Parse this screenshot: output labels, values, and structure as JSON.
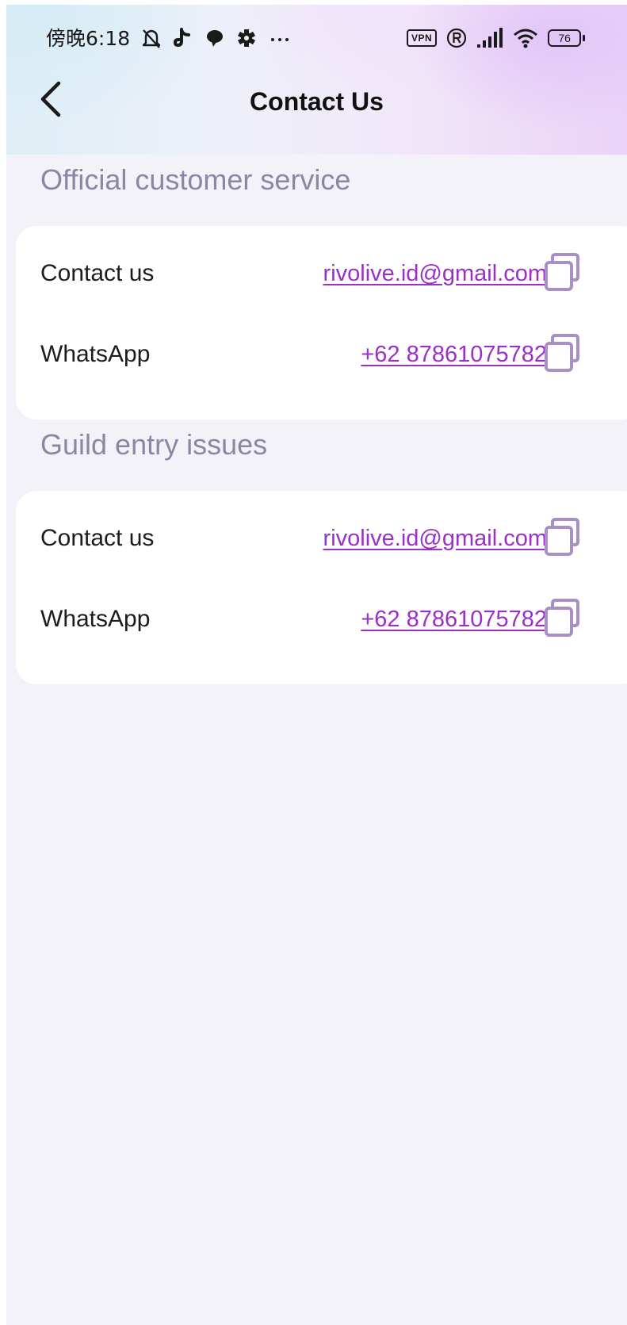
{
  "status_bar": {
    "time": "傍晚6:18",
    "vpn_label": "VPN",
    "battery_level": "76",
    "left_icons": [
      "bell-off-icon",
      "tiktok-icon",
      "chat-bubble-icon",
      "gear-icon",
      "more-icon"
    ],
    "right_icons": [
      "vpn-icon",
      "registered-icon",
      "signal-icon",
      "wifi-icon",
      "battery-icon"
    ]
  },
  "header": {
    "title": "Contact Us",
    "back_icon": "chevron-left-icon"
  },
  "sections": [
    {
      "title": "Official customer service",
      "rows": [
        {
          "label": "Contact us",
          "value": "rivolive.id@gmail.com",
          "action_icon": "copy-icon"
        },
        {
          "label": "WhatsApp",
          "value": "+62 87861075782",
          "action_icon": "copy-icon"
        }
      ]
    },
    {
      "title": "Guild entry issues",
      "rows": [
        {
          "label": "Contact us",
          "value": "rivolive.id@gmail.com",
          "action_icon": "copy-icon"
        },
        {
          "label": "WhatsApp",
          "value": "+62 87861075782",
          "action_icon": "copy-icon"
        }
      ]
    }
  ],
  "colors": {
    "page_background": "#f3f2f9",
    "card_background": "#ffffff",
    "section_title": "#8a87a3",
    "link": "#9a30c9",
    "copy_icon": "#a890c4"
  }
}
